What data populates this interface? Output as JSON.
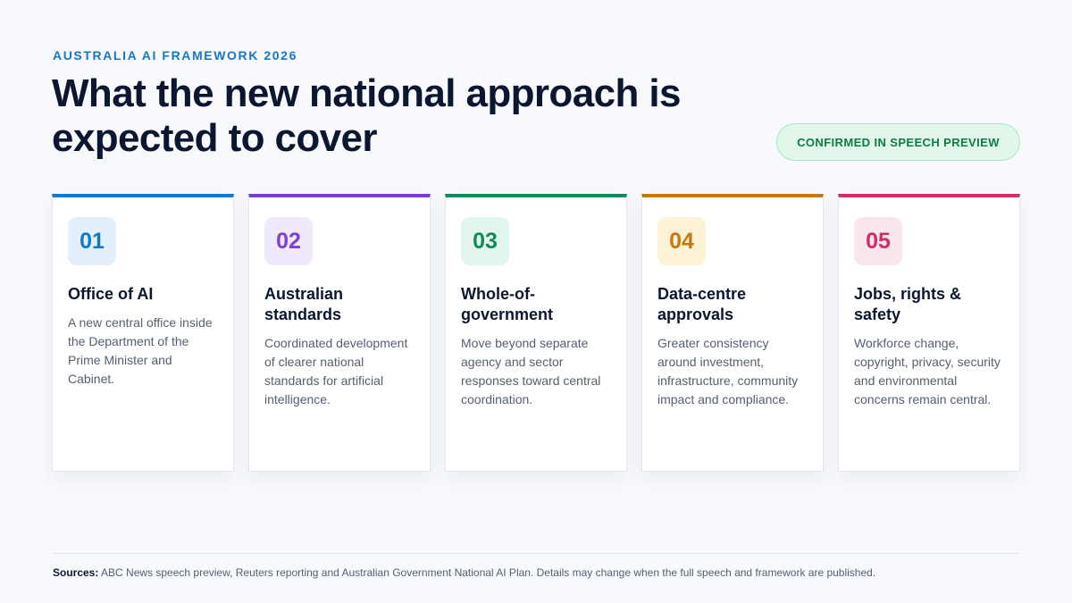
{
  "header": {
    "eyebrow": "AUSTRALIA AI FRAMEWORK 2026",
    "title": "What the new national approach is expected to cover",
    "badge": "CONFIRMED IN SPEECH PREVIEW"
  },
  "cards": [
    {
      "number": "01",
      "title": "Office of AI",
      "text": "A new central office inside the Department of the Prime Minister and Cabinet.",
      "accent": "#1577c9",
      "tint": "#e3f0fb"
    },
    {
      "number": "02",
      "title": "Australian standards",
      "text": "Coordinated development of clearer national standards for artificial intelligence.",
      "accent": "#7b3fd1",
      "tint": "#f0e8fb"
    },
    {
      "number": "03",
      "title": "Whole-of-government",
      "text": "Move beyond separate agency and sector responses toward central coordination.",
      "accent": "#12895a",
      "tint": "#e1f6ec"
    },
    {
      "number": "04",
      "title": "Data-centre approvals",
      "text": "Greater consistency around investment, infrastructure, community impact and compliance.",
      "accent": "#c9780f",
      "tint": "#fdf1d6"
    },
    {
      "number": "05",
      "title": "Jobs, rights & safety",
      "text": "Workforce change, copyright, privacy, security and environmental concerns remain central.",
      "accent": "#cc2f6a",
      "tint": "#fce6ee"
    }
  ],
  "footer": {
    "sources_label": "Sources:",
    "sources_text": "ABC News speech preview, Reuters reporting and Australian Government National AI Plan. Details may change when the full speech and framework are published."
  }
}
